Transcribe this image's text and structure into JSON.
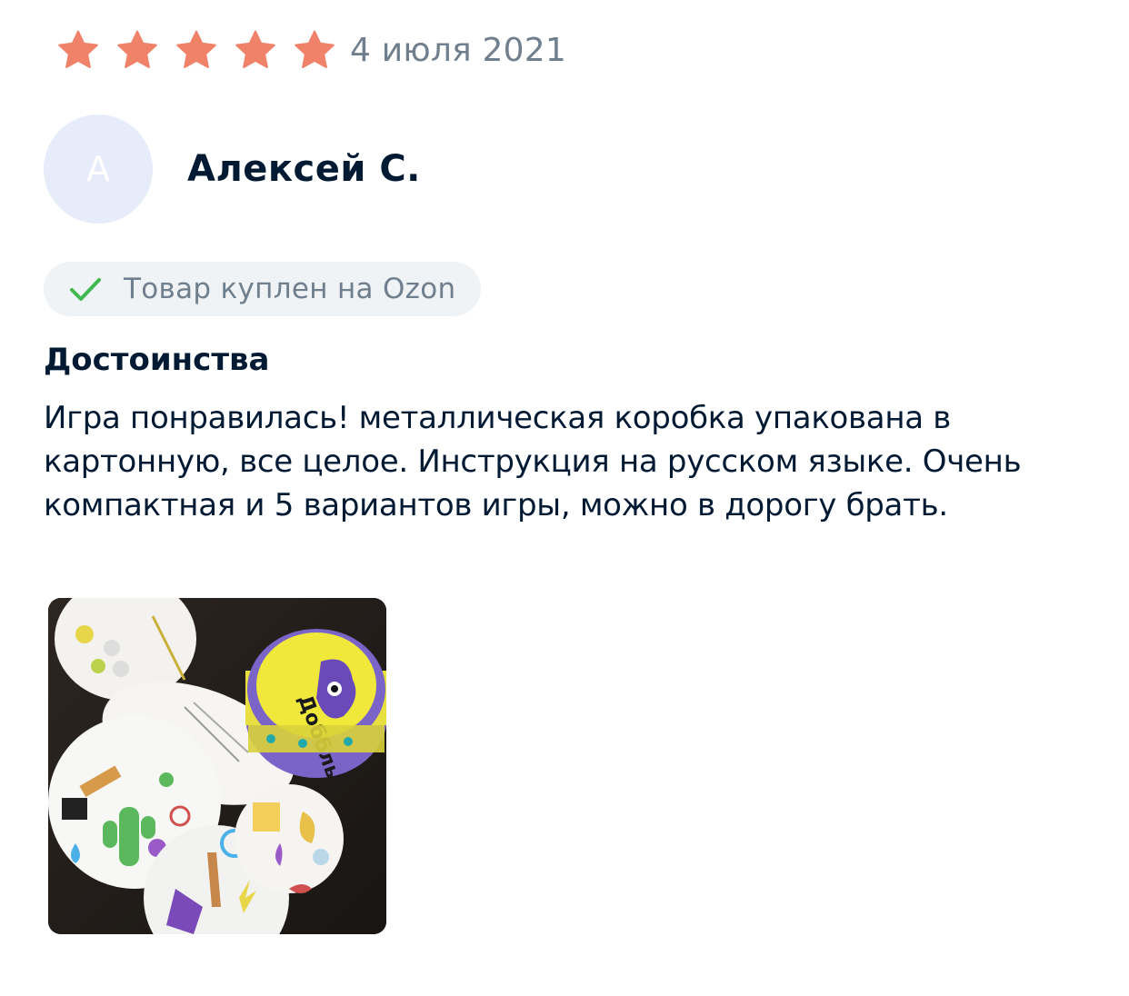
{
  "review": {
    "rating": 5,
    "rating_max": 5,
    "date": "4 июля 2021",
    "star_color": "#f1826a",
    "author": {
      "initial": "А",
      "name": "Алексей С."
    },
    "verified_badge": {
      "icon": "check-icon",
      "text": "Товар куплен на Ozon",
      "icon_color": "#3fb950"
    },
    "pros": {
      "title": "Достоинства",
      "text": "Игра понравилась! металлическая коробка упакована в картонную, все целое. Инструкция на русском языке. Очень компактная и 5 вариантов игры, можно в дорогу брать."
    },
    "photos": [
      {
        "alt_icon": "photo-thumbnail",
        "box_text": "Доббль"
      }
    ]
  }
}
